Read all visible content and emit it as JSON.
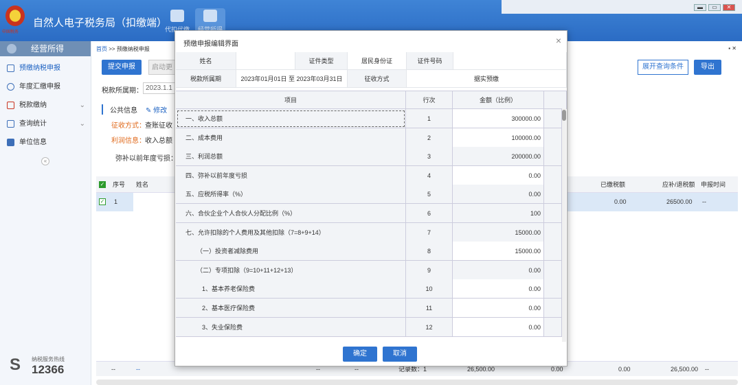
{
  "header": {
    "app_title": "自然人电子税务局（扣缴端）",
    "emblem_text": "中国税务",
    "nav": [
      "代扣代缴",
      "经营所得"
    ]
  },
  "window_controls": [
    "▬",
    "▭",
    "✕"
  ],
  "sidebar": {
    "title": "经营所得",
    "items": [
      {
        "label": "预缴纳税申报",
        "chevron": ""
      },
      {
        "label": "年度汇缴申报",
        "chevron": ""
      },
      {
        "label": "税款缴纳",
        "chevron": "⌄"
      },
      {
        "label": "查询统计",
        "chevron": "⌄"
      },
      {
        "label": "单位信息",
        "chevron": ""
      }
    ],
    "collapse_glyph": "«",
    "hotline_label": "纳税服务热线",
    "hotline_number": "12366"
  },
  "main": {
    "breadcrumb_home": "首页",
    "breadcrumb_sep": ">>",
    "breadcrumb_current": "预缴纳税申报",
    "submit_button": "提交申报",
    "auto_button": "启动更",
    "expand_button": "展开查询条件",
    "export_button": "导出",
    "period_label": "税款所属期：",
    "period_value": "2023.1.1",
    "public_info_label": "公共信息",
    "edit_label": "修改",
    "levy_label": "征收方式：",
    "levy_value": "查账征收",
    "profit_label": "利润信息：",
    "profit_value": "收入总额",
    "loss_label": "弥补以前年度亏损：",
    "grid": {
      "headers": [
        "序号",
        "姓名",
        "已缴税额",
        "应补/退税额",
        "申报时间"
      ],
      "row": {
        "index": "1",
        "paid": "0.00",
        "due": "26500.00",
        "time": "--"
      },
      "footer": [
        "--",
        "--",
        "--",
        "--",
        "记录数：1",
        "26,500.00",
        "0.00",
        "0.00",
        "26,500.00",
        "--"
      ]
    }
  },
  "modal": {
    "title": "预缴申报编辑界面",
    "close": "×",
    "info": {
      "name_label": "姓名",
      "name_value": "",
      "id_type_label": "证件类型",
      "id_type_value": "居民身份证",
      "id_no_label": "证件号码",
      "id_no_value": "",
      "period_label": "税款所属期",
      "period_value": "2023年01月01日 至 2023年03月31日",
      "levy_label": "征收方式",
      "levy_value": "据实预缴"
    },
    "columns": [
      "项目",
      "行次",
      "金额（比例）"
    ],
    "rows": [
      {
        "name": "一、收入总额",
        "line": "1",
        "amount": "300000.00",
        "editable": true
      },
      {
        "name": "二、成本费用",
        "line": "2",
        "amount": "100000.00",
        "editable": true
      },
      {
        "name": "三、利润总额",
        "line": "3",
        "amount": "200000.00",
        "editable": false
      },
      {
        "name": "四、弥补以前年度亏损",
        "line": "4",
        "amount": "0.00",
        "editable": true
      },
      {
        "name": "五、应税所得率（%）",
        "line": "5",
        "amount": "0.00",
        "editable": false
      },
      {
        "name": "六、合伙企业个人合伙人分配比例（%）",
        "line": "6",
        "amount": "100",
        "editable": false
      },
      {
        "name": "七、允许扣除的个人费用及其他扣除（7=8+9+14）",
        "line": "7",
        "amount": "15000.00",
        "editable": false
      },
      {
        "name": "（一）投资者减除费用",
        "line": "8",
        "amount": "15000.00",
        "editable": true
      },
      {
        "name": "（二）专项扣除（9=10+11+12+13）",
        "line": "9",
        "amount": "0.00",
        "editable": false
      },
      {
        "name": "1、基本养老保险费",
        "line": "10",
        "amount": "0.00",
        "editable": true
      },
      {
        "name": "2、基本医疗保险费",
        "line": "11",
        "amount": "0.00",
        "editable": true
      },
      {
        "name": "3、失业保险费",
        "line": "12",
        "amount": "0.00",
        "editable": true
      }
    ],
    "confirm_button": "确定",
    "cancel_button": "取消"
  }
}
